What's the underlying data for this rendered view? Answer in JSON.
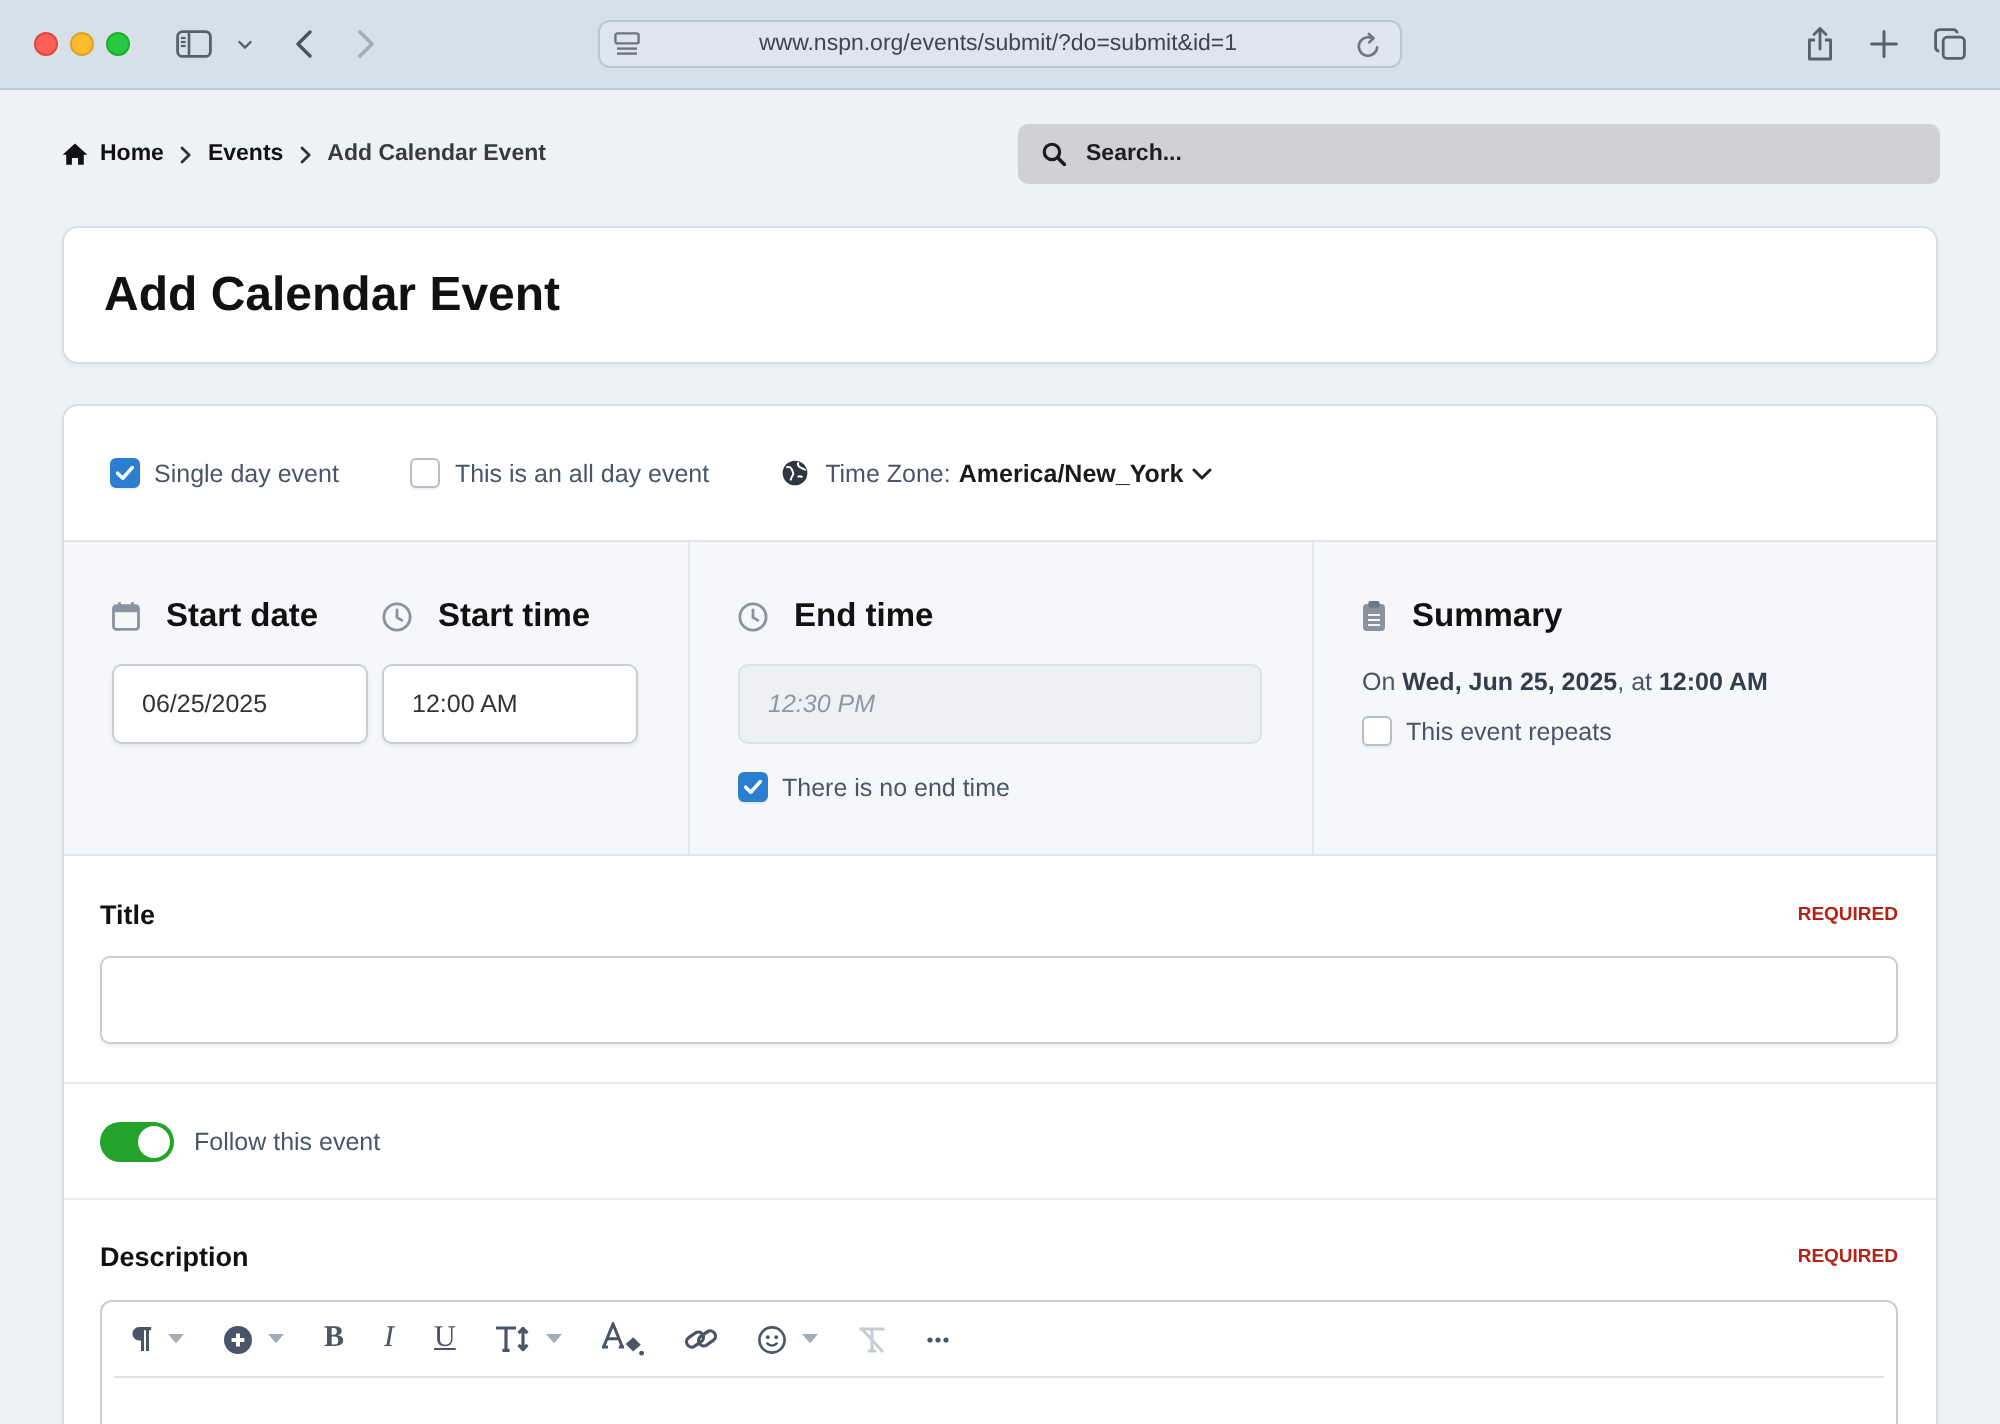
{
  "browser": {
    "url": "www.nspn.org/events/submit/?do=submit&id=1"
  },
  "breadcrumb": [
    {
      "label": "Home",
      "current": false
    },
    {
      "label": "Events",
      "current": false
    },
    {
      "label": "Add Calendar Event",
      "current": true
    }
  ],
  "search": {
    "placeholder": "Search..."
  },
  "page_title": "Add Calendar Event",
  "event_options": [
    {
      "label": "Single day event",
      "checked": true
    },
    {
      "label": "This is an all day event",
      "checked": false
    }
  ],
  "time_zone": {
    "label": "Time Zone:",
    "value": "America/New_York"
  },
  "start": {
    "date_label": "Start date",
    "date_value": "06/25/2025",
    "time_label": "Start time",
    "time_value": "12:00 AM"
  },
  "end": {
    "label": "End time",
    "placeholder": "12:30 PM",
    "disabled": true,
    "no_end_time": {
      "label": "There is no end time",
      "checked": true
    }
  },
  "summary": {
    "heading": "Summary",
    "text": "On **Wed, Jun 25, 2025**, at **12:00 AM**",
    "repeats": {
      "label": "This event repeats",
      "checked": false
    }
  },
  "title_field": {
    "label": "Title",
    "badge": "REQUIRED"
  },
  "follow": {
    "label": "Follow this event",
    "on": true
  },
  "description": {
    "label": "Description",
    "badge": "REQUIRED",
    "toolbar": [
      {
        "kind": "paragraph",
        "dropdown": true,
        "disabled": false
      },
      {
        "kind": "insert",
        "dropdown": true,
        "disabled": false
      },
      {
        "kind": "bold",
        "label": "B",
        "dropdown": false,
        "disabled": false
      },
      {
        "kind": "italic",
        "label": "I",
        "dropdown": false,
        "disabled": false
      },
      {
        "kind": "underline",
        "label": "U",
        "dropdown": false,
        "disabled": false
      },
      {
        "kind": "size",
        "dropdown": true,
        "disabled": false
      },
      {
        "kind": "color",
        "dropdown": false,
        "disabled": false
      },
      {
        "kind": "link",
        "dropdown": false,
        "disabled": false
      },
      {
        "kind": "emoji",
        "dropdown": true,
        "disabled": false
      },
      {
        "kind": "clear",
        "dropdown": false,
        "disabled": true
      },
      {
        "kind": "more",
        "dropdown": false,
        "disabled": false
      }
    ]
  }
}
